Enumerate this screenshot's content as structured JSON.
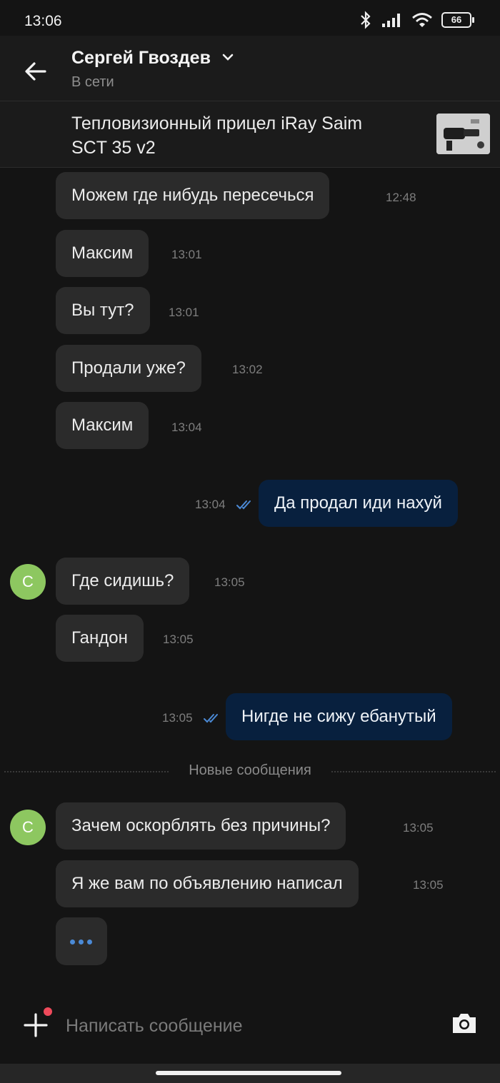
{
  "status_bar": {
    "time": "13:06",
    "battery": "66",
    "icons": [
      "bluetooth-icon",
      "signal-icon",
      "wifi-icon",
      "battery-icon"
    ]
  },
  "header": {
    "contact_name": "Сергей Гвоздев",
    "contact_status": "В сети"
  },
  "listing": {
    "title": "Тепловизионный прицел iRay Saim SCT 35 v2"
  },
  "messages": [
    {
      "direction": "in",
      "text": "Можем где нибудь пересечься",
      "time": "12:48"
    },
    {
      "direction": "in",
      "text": "Максим",
      "time": "13:01"
    },
    {
      "direction": "in",
      "text": "Вы тут?",
      "time": "13:01"
    },
    {
      "direction": "in",
      "text": "Продали уже?",
      "time": "13:02"
    },
    {
      "direction": "in",
      "text": "Максим",
      "time": "13:04"
    },
    {
      "direction": "out",
      "text": "Да продал иди нахуй",
      "time": "13:04",
      "read": true
    },
    {
      "direction": "in",
      "text": "Где сидишь?",
      "time": "13:05",
      "avatar": "С"
    },
    {
      "direction": "in",
      "text": "Гандон",
      "time": "13:05"
    },
    {
      "direction": "out",
      "text": "Нигде не сижу ебанутый",
      "time": "13:05",
      "read": true
    },
    {
      "direction": "in",
      "text": "Зачем оскорблять без причины?",
      "time": "13:05",
      "avatar": "С"
    },
    {
      "direction": "in",
      "text": "Я же вам по объявлению написал",
      "time": "13:05"
    }
  ],
  "new_messages_divider": "Новые сообщения",
  "typing_indicator": "typing-dots",
  "composer": {
    "placeholder": "Написать сообщение"
  },
  "colors": {
    "background": "#141414",
    "incoming_bubble": "#2b2b2b",
    "outgoing_bubble": "#08203e",
    "avatar": "#8dc760",
    "read_ticks": "#4b8ad6",
    "notification_dot": "#ef4a5b"
  }
}
